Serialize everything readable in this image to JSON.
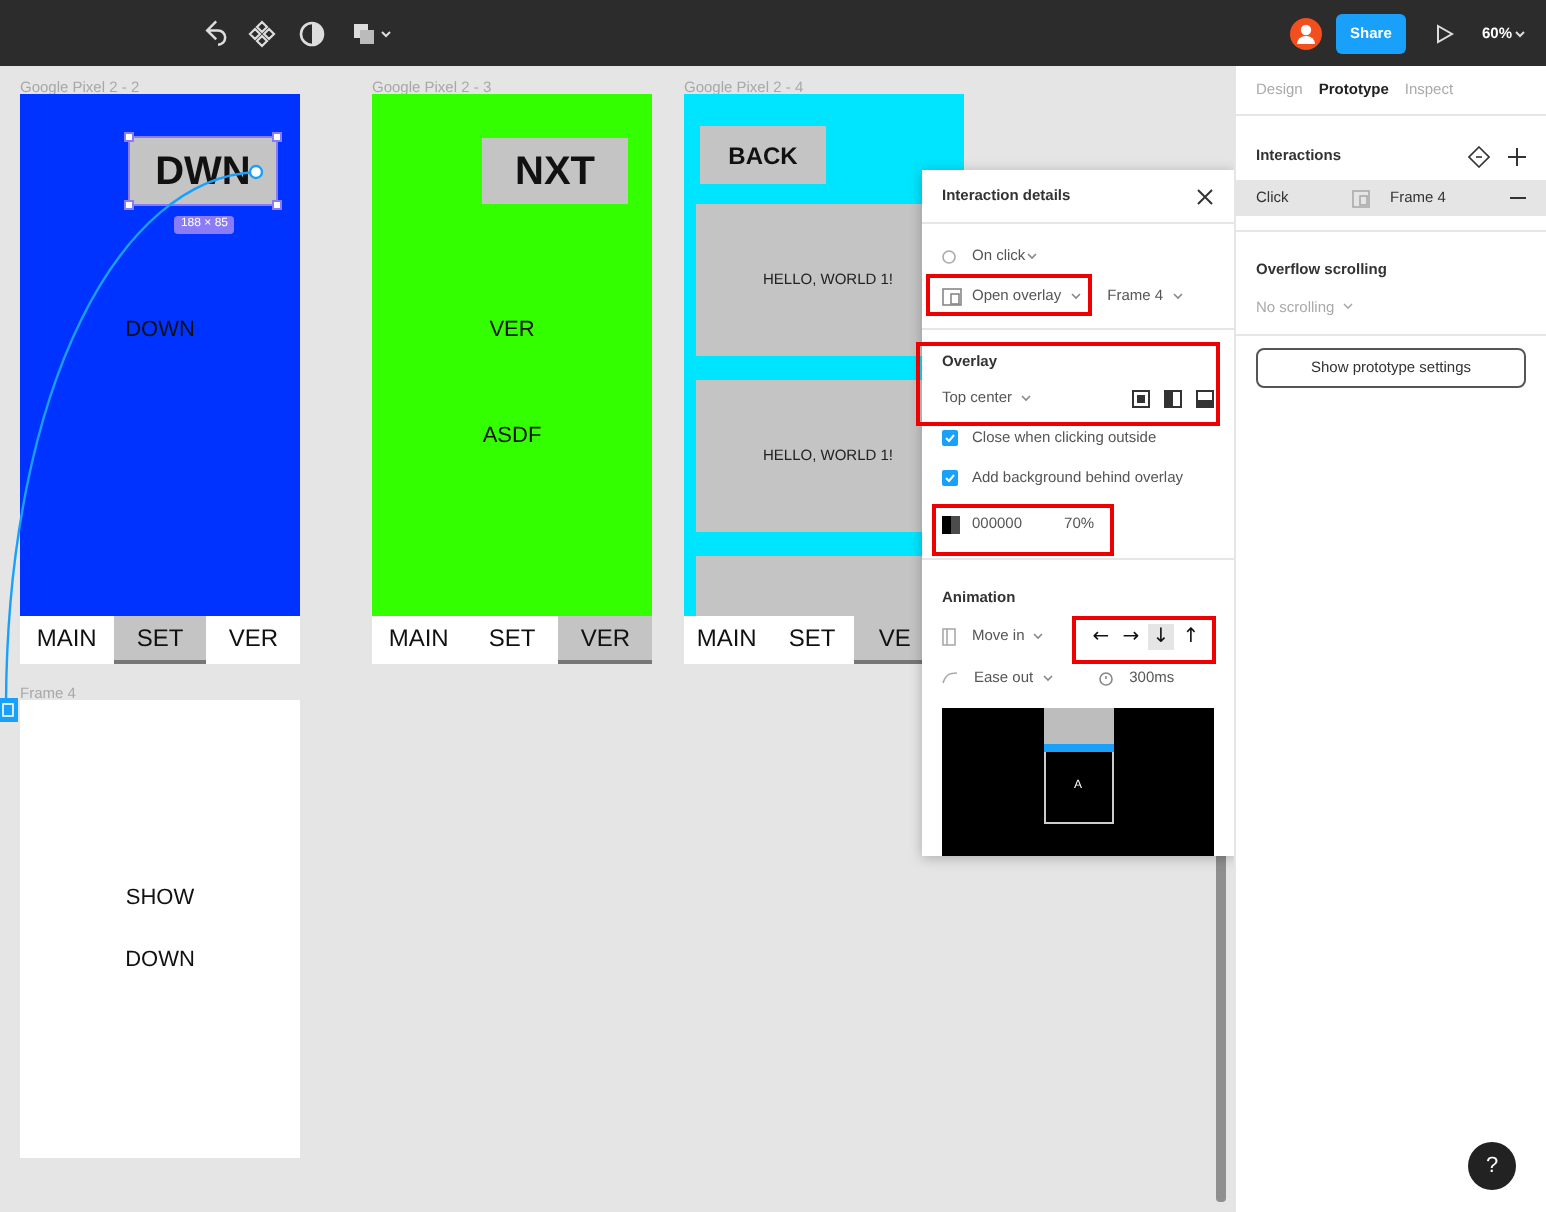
{
  "toolbar": {
    "share": "Share",
    "zoom": "60%"
  },
  "canvas": {
    "frames": [
      {
        "title": "Google Pixel 2 - 2",
        "kind": "screen",
        "color": "#0033ff",
        "button": {
          "text": "DWN",
          "selected": true,
          "size": "188 × 85"
        },
        "texts": [
          "DOWN"
        ],
        "tabs": [
          {
            "label": "MAIN",
            "selected": false
          },
          {
            "label": "SET",
            "selected": true
          },
          {
            "label": "VER",
            "selected": false
          }
        ]
      },
      {
        "title": "Google Pixel 2 - 3",
        "kind": "screen",
        "color": "#33ff00",
        "button": {
          "text": "NXT",
          "selected": false
        },
        "texts": [
          "VER",
          "ASDF"
        ],
        "tabs": [
          {
            "label": "MAIN",
            "selected": false
          },
          {
            "label": "SET",
            "selected": false
          },
          {
            "label": "VER",
            "selected": true
          }
        ]
      },
      {
        "title": "Google Pixel 2 - 4",
        "kind": "list",
        "color": "#00e5ff",
        "button": {
          "text": "BACK",
          "selected": false
        },
        "cards": [
          {
            "kind": "text",
            "text": "HELLO, WORLD 1!"
          },
          {
            "kind": "text",
            "text": "HELLO, WORLD 1!"
          },
          {
            "kind": "blank"
          }
        ],
        "tabs": [
          {
            "label": "MAIN",
            "selected": false
          },
          {
            "label": "SET",
            "selected": false
          },
          {
            "label": "VE",
            "selected": true
          }
        ]
      },
      {
        "title": "Frame 4",
        "kind": "overlay",
        "color": "#ffffff",
        "texts": [
          "SHOW",
          "DOWN"
        ]
      }
    ]
  },
  "interaction_details": {
    "title": "Interaction details",
    "trigger": "On click",
    "action": "Open overlay",
    "destination": "Frame 4",
    "overlay": {
      "title": "Overlay",
      "position": "Top center",
      "options": [
        {
          "label": "Close when clicking outside",
          "checked": true
        },
        {
          "label": "Add background behind overlay",
          "checked": true
        }
      ],
      "background": {
        "color": "000000",
        "opacity": "70%"
      }
    },
    "animation": {
      "title": "Animation",
      "type": "Move in",
      "directions": [
        {
          "symbol": "←",
          "selected": false
        },
        {
          "symbol": "→",
          "selected": false
        },
        {
          "symbol": "↓",
          "selected": true
        },
        {
          "symbol": "↑",
          "selected": false
        }
      ],
      "easing": "Ease out",
      "duration": "300ms",
      "preview_label": "A"
    }
  },
  "properties_panel": {
    "tabs": [
      {
        "label": "Design",
        "selected": false
      },
      {
        "label": "Prototype",
        "selected": true
      },
      {
        "label": "Inspect",
        "selected": false
      }
    ],
    "interactions_title": "Interactions",
    "interaction": {
      "trigger": "Click",
      "destination": "Frame 4"
    },
    "overflow_title": "Overflow scrolling",
    "overflow_value": "No scrolling",
    "settings_button": "Show prototype settings"
  },
  "help": "?"
}
